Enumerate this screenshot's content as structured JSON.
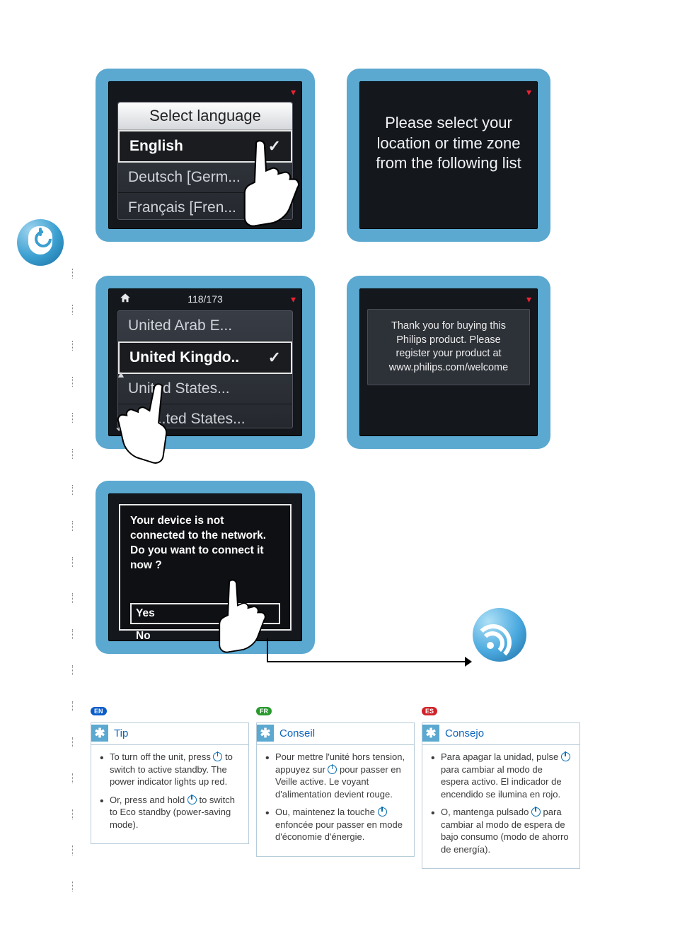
{
  "panel1": {
    "title": "Select language",
    "items": [
      "English",
      "Deutsch [Germ...",
      "Français [Fren..."
    ],
    "selected_index": 0
  },
  "panel2": {
    "message": "Please select your location or time zone from the following list"
  },
  "panel3": {
    "counter": "118/173",
    "items": [
      "United Arab E...",
      "United Kingdo..",
      "United States...",
      "...ted States..."
    ],
    "selected_index": 1
  },
  "panel4": {
    "message": "Thank you for buying this Philips product.  Please register your product at www.philips.com/welcome"
  },
  "panel5": {
    "question": "Your device is not connected to the network.  Do you want to connect it now ?",
    "options": [
      "Yes",
      "No"
    ],
    "selected_index": 0
  },
  "tips": {
    "en": {
      "badge": "EN",
      "title": "Tip",
      "b1a": "To turn off the unit, press ",
      "b1b": " to switch to active standby. The power indicator lights up red.",
      "b2a": "Or, press and hold ",
      "b2b": " to switch to Eco standby (power-saving mode)."
    },
    "fr": {
      "badge": "FR",
      "title": "Conseil",
      "b1a": "Pour mettre l'unité hors tension, appuyez sur ",
      "b1b": " pour passer en Veille active. Le voyant d'alimentation devient rouge.",
      "b2a": "Ou, maintenez la touche ",
      "b2b": " enfoncée pour passer en mode d'économie d'énergie."
    },
    "es": {
      "badge": "ES",
      "title": "Consejo",
      "b1a": "Para apagar la unidad, pulse ",
      "b1b": " para cambiar al modo de espera activo. El indicador de encendido se ilumina en rojo.",
      "b2a": "O, mantenga pulsado ",
      "b2b": " para cambiar al modo de espera de bajo consumo (modo de ahorro de energía)."
    }
  }
}
